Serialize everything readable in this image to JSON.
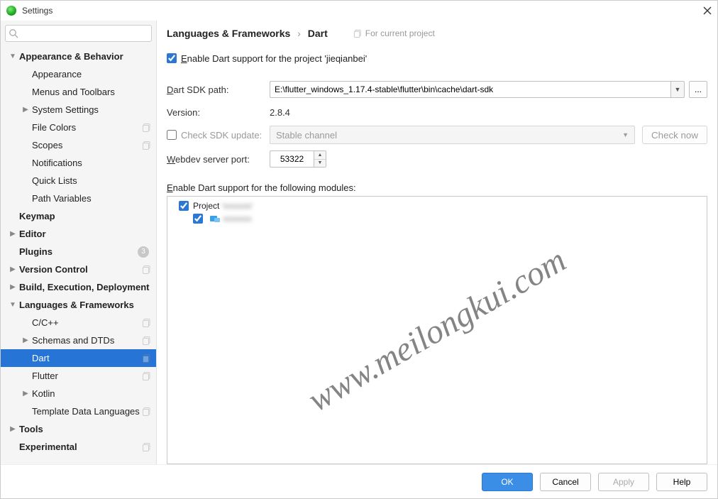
{
  "window": {
    "title": "Settings"
  },
  "sidebar": {
    "search_placeholder": "",
    "items": [
      {
        "label": "Appearance & Behavior",
        "bold": true,
        "arrow": "down",
        "indent": 0
      },
      {
        "label": "Appearance",
        "indent": 1
      },
      {
        "label": "Menus and Toolbars",
        "indent": 1
      },
      {
        "label": "System Settings",
        "arrow": "right",
        "indent": 1
      },
      {
        "label": "File Colors",
        "indent": 1,
        "copy": true
      },
      {
        "label": "Scopes",
        "indent": 1,
        "copy": true
      },
      {
        "label": "Notifications",
        "indent": 1
      },
      {
        "label": "Quick Lists",
        "indent": 1
      },
      {
        "label": "Path Variables",
        "indent": 1
      },
      {
        "label": "Keymap",
        "bold": true,
        "indent": 0
      },
      {
        "label": "Editor",
        "bold": true,
        "arrow": "right",
        "indent": 0
      },
      {
        "label": "Plugins",
        "bold": true,
        "indent": 0,
        "badge": "3"
      },
      {
        "label": "Version Control",
        "bold": true,
        "arrow": "right",
        "indent": 0,
        "copy": true
      },
      {
        "label": "Build, Execution, Deployment",
        "bold": true,
        "arrow": "right",
        "indent": 0
      },
      {
        "label": "Languages & Frameworks",
        "bold": true,
        "arrow": "down",
        "indent": 0
      },
      {
        "label": "C/C++",
        "indent": 1,
        "copy": true
      },
      {
        "label": "Schemas and DTDs",
        "arrow": "right",
        "indent": 1,
        "copy": true
      },
      {
        "label": "Dart",
        "indent": 1,
        "copy": true,
        "selected": true
      },
      {
        "label": "Flutter",
        "indent": 1,
        "copy": true
      },
      {
        "label": "Kotlin",
        "arrow": "right",
        "indent": 1
      },
      {
        "label": "Template Data Languages",
        "indent": 1,
        "copy": true
      },
      {
        "label": "Tools",
        "bold": true,
        "arrow": "right",
        "indent": 0
      },
      {
        "label": "Experimental",
        "bold": true,
        "indent": 0,
        "copy": true
      }
    ]
  },
  "breadcrumb": {
    "parent": "Languages & Frameworks",
    "current": "Dart",
    "scope": "For current project"
  },
  "form": {
    "enable_label": "Enable Dart support for the project 'jieqianbei'",
    "enable_checked": true,
    "sdk_path_label": "Dart SDK path:",
    "sdk_path_value": "E:\\flutter_windows_1.17.4-stable\\flutter\\bin\\cache\\dart-sdk",
    "version_label": "Version:",
    "version_value": "2.8.4",
    "check_update_label": "Check SDK update:",
    "check_update_checked": false,
    "channel_value": "Stable channel",
    "check_now_label": "Check now",
    "webdev_label": "Webdev server port:",
    "webdev_value": "53322",
    "modules_heading": "Enable Dart support for the following modules:",
    "modules": {
      "project_label": "Project",
      "project_checked": true,
      "child_checked": true
    }
  },
  "footer": {
    "ok": "OK",
    "cancel": "Cancel",
    "apply": "Apply",
    "help": "Help"
  },
  "watermark": "www.meilongkui.com"
}
